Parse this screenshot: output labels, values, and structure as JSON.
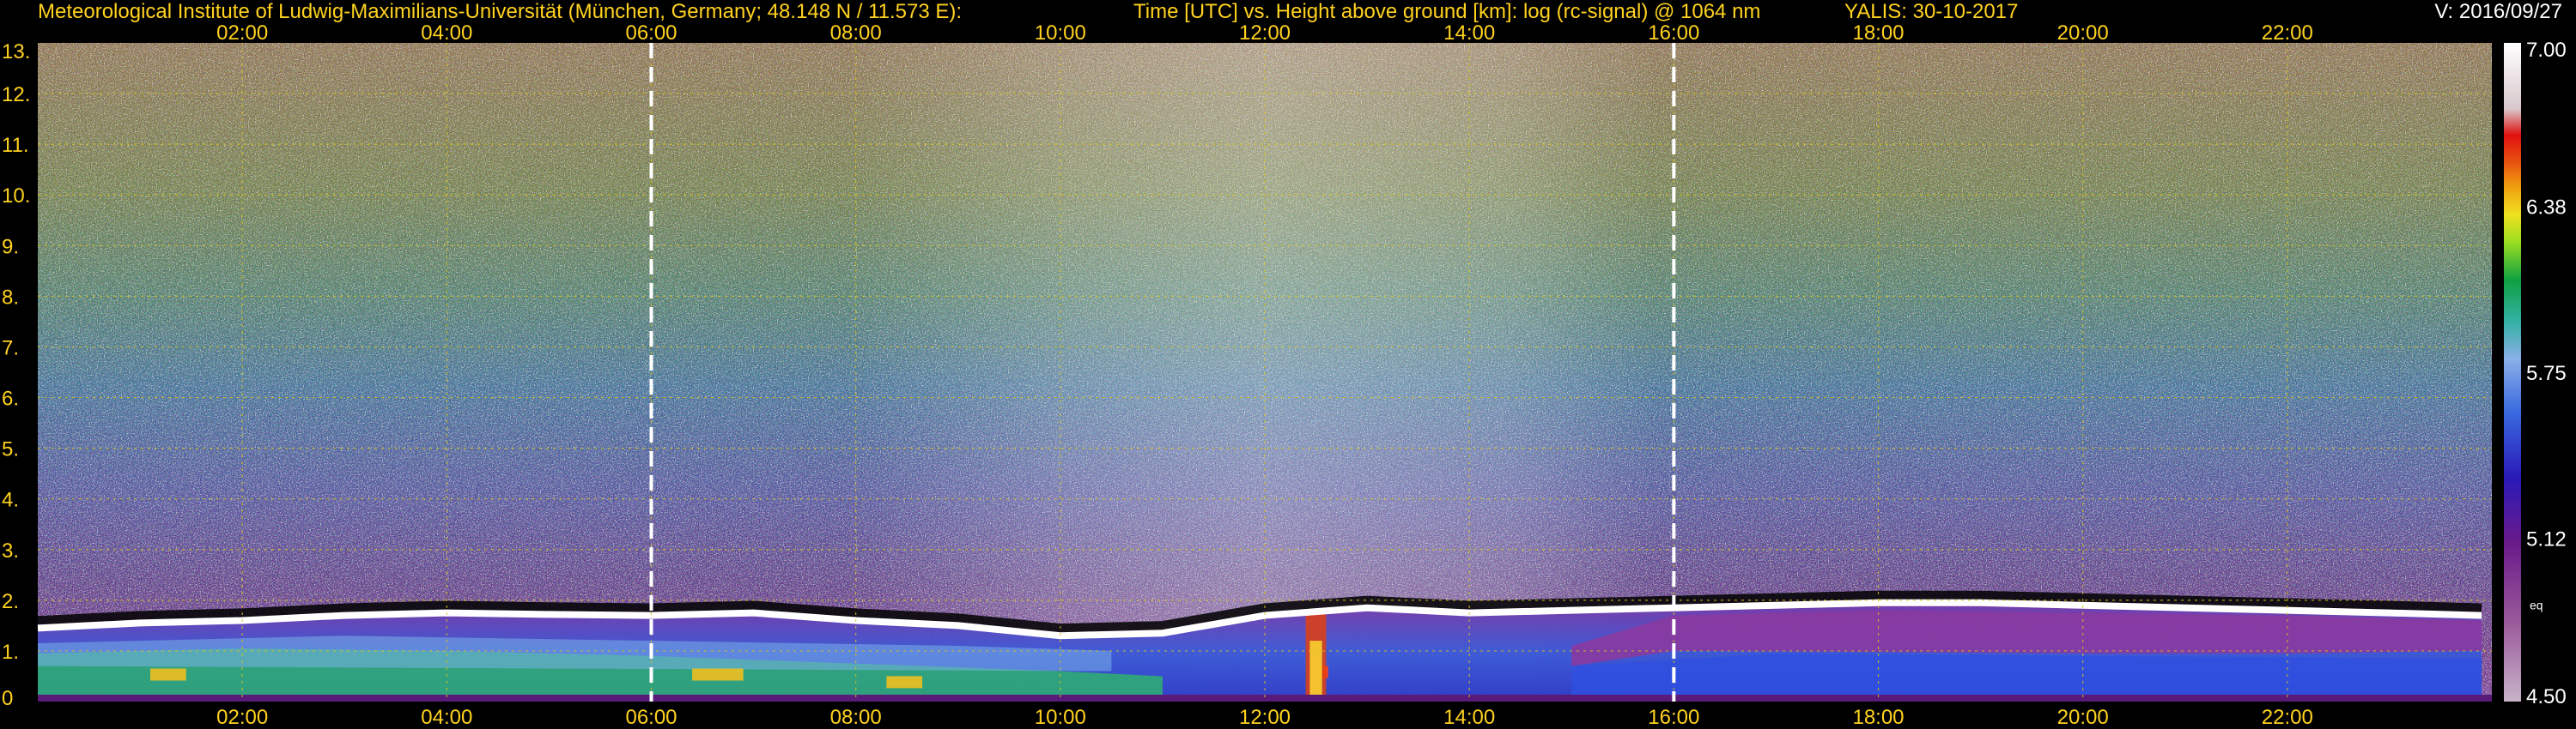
{
  "header": {
    "institute": "Meteorological Institute of Ludwig-Maximilians-Universität (München, Germany; 48.148 N / 11.573 E):",
    "axis_description": "Time [UTC] vs. Height above ground [km]: log (rc-signal) @ 1064 nm",
    "station_date": "YALIS: 30-10-2017",
    "version": "V: 2016/09/27"
  },
  "colors": {
    "label": "#ffd21f",
    "background": "#000000",
    "grid": "#d8c21a",
    "marker_line": "#ffffff"
  },
  "chart_data": {
    "type": "heatmap",
    "title": "Time [UTC] vs. Height above ground [km]: log (rc-signal) @ 1064 nm",
    "xlabel": "Time [UTC]",
    "ylabel": "Height above ground [km]",
    "x_range_hours": [
      0,
      24
    ],
    "y_range_km": [
      0,
      13
    ],
    "x_ticks": [
      "02:00",
      "04:00",
      "06:00",
      "08:00",
      "10:00",
      "12:00",
      "14:00",
      "16:00",
      "18:00",
      "20:00",
      "22:00"
    ],
    "x_tick_hours": [
      2,
      4,
      6,
      8,
      10,
      12,
      14,
      16,
      18,
      20,
      22
    ],
    "y_ticks": [
      "0",
      "1.",
      "2.",
      "3.",
      "4.",
      "5.",
      "6.",
      "7.",
      "8.",
      "9.",
      "10.",
      "11.",
      "12.",
      "13."
    ],
    "y_tick_values": [
      0,
      1,
      2,
      3,
      4,
      5,
      6,
      7,
      8,
      9,
      10,
      11,
      12,
      13
    ],
    "grid": true,
    "marker_lines_hours": [
      6,
      16
    ],
    "colorbar": {
      "range": [
        4.5,
        7.0
      ],
      "tick_labels": [
        "7.00",
        "6.38",
        "5.75",
        "5.12",
        "4.50"
      ],
      "tick_values": [
        7.0,
        6.38,
        5.75,
        5.12,
        4.5
      ],
      "extra_label": "eq"
    },
    "boundary_layer_top_km": [
      [
        0.0,
        1.45
      ],
      [
        1.0,
        1.55
      ],
      [
        2.0,
        1.6
      ],
      [
        3.0,
        1.7
      ],
      [
        4.0,
        1.75
      ],
      [
        5.0,
        1.72
      ],
      [
        6.0,
        1.7
      ],
      [
        7.0,
        1.75
      ],
      [
        8.0,
        1.6
      ],
      [
        9.0,
        1.5
      ],
      [
        10.0,
        1.3
      ],
      [
        11.0,
        1.35
      ],
      [
        12.0,
        1.7
      ],
      [
        13.0,
        1.85
      ],
      [
        14.0,
        1.75
      ],
      [
        15.0,
        1.8
      ],
      [
        16.0,
        1.85
      ],
      [
        17.0,
        1.9
      ],
      [
        18.0,
        1.95
      ],
      [
        19.0,
        1.95
      ],
      [
        20.0,
        1.9
      ],
      [
        21.0,
        1.85
      ],
      [
        22.0,
        1.8
      ],
      [
        23.0,
        1.75
      ],
      [
        23.9,
        1.7
      ]
    ]
  }
}
